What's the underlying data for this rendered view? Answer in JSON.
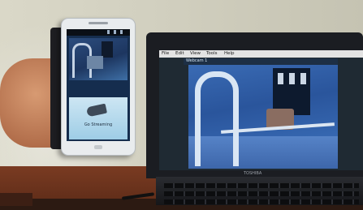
{
  "scene": {
    "description_label": "Phone and laptop showing a remote camera feed"
  },
  "phone": {
    "tile_label": "Go Streaming"
  },
  "laptop": {
    "menu_items": [
      "File",
      "Edit",
      "View",
      "Tools",
      "Help"
    ],
    "window_title": "Webcam 1",
    "brand": "TOSHIBA"
  },
  "colors": {
    "feed_blue": "#3a6bb4",
    "desk_wood": "#7a3b22"
  }
}
